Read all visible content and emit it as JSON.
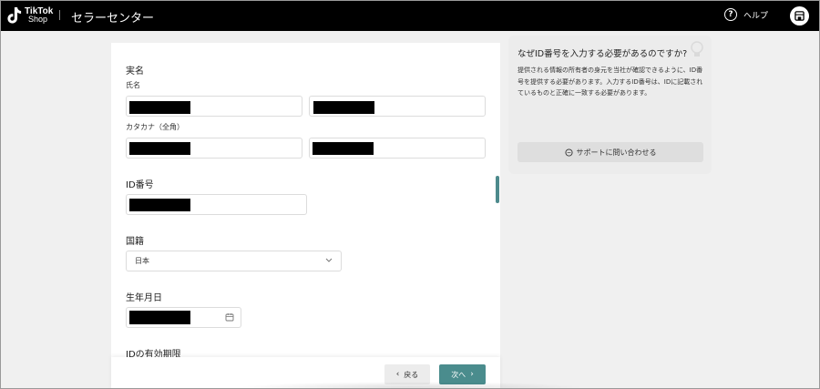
{
  "header": {
    "logo_line1": "TikTok",
    "logo_line2": "Shop",
    "app_title": "セラーセンター",
    "help_label": "ヘルプ",
    "help_icon": "question-circle-icon",
    "avatar_icon": "store-icon"
  },
  "form": {
    "real_name_section": "実名",
    "name_label": "氏名",
    "katakana_label": "カタカナ（全角）",
    "id_number_section": "ID番号",
    "nationality_section": "国籍",
    "nationality_value": "日本",
    "birthdate_section": "生年月日",
    "id_expiry_section": "IDの有効期限",
    "redacted_note": "redacted"
  },
  "footer": {
    "back_label": "戻る",
    "next_label": "次へ"
  },
  "info_card": {
    "title": "なぜID番号を入力する必要があるのですか?",
    "body": "提供される情報の所有者の身元を当社が確認できるように、ID番号を提供する必要があります。入力するID番号は、IDに記載されているものと正確に一致する必要があります。",
    "support_button": "サポートに問い合わせる"
  },
  "colors": {
    "header_bg": "#000000",
    "accent": "#4a8c8d",
    "page_bg": "#f0f0f0"
  }
}
